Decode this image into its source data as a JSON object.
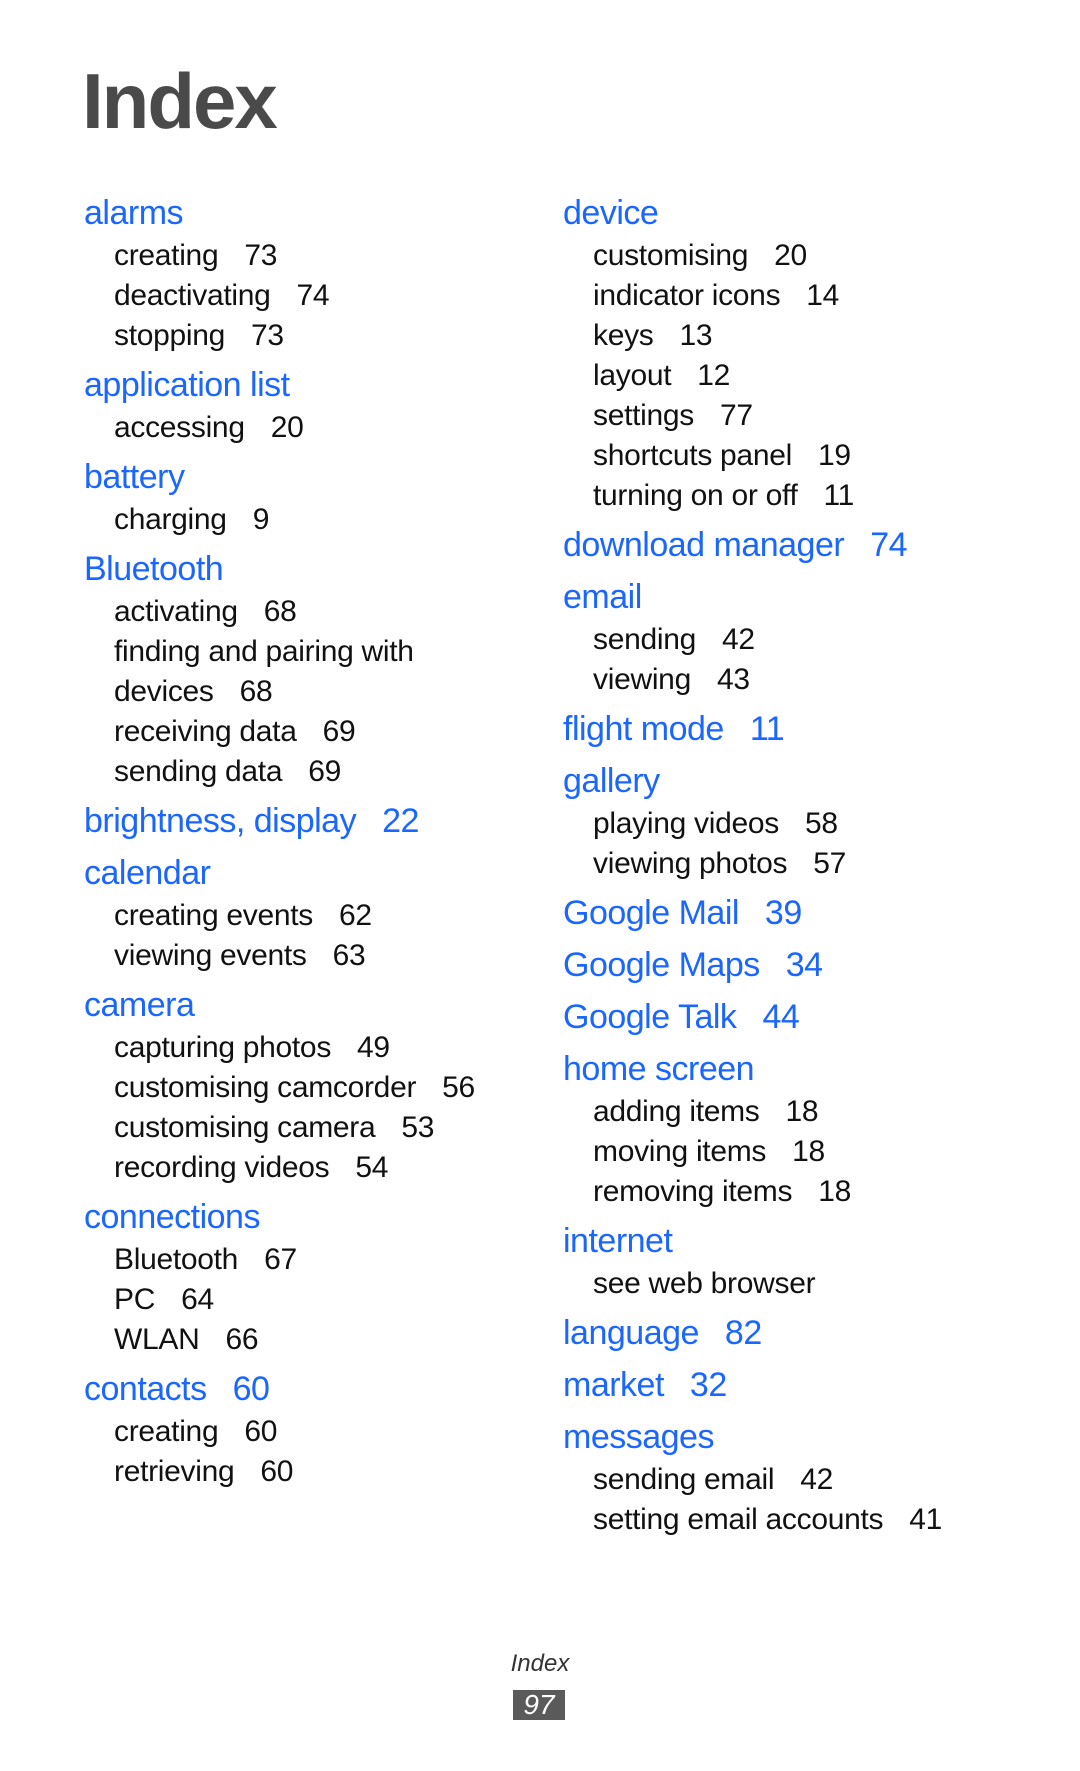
{
  "page": {
    "title": "Index",
    "footer_label": "Index",
    "page_number": "97",
    "accent_color": "#1a66ff"
  },
  "left": [
    {
      "term": "alarms",
      "page": "",
      "subs": [
        {
          "text": "creating",
          "page": "73"
        },
        {
          "text": "deactivating",
          "page": "74"
        },
        {
          "text": "stopping",
          "page": "73"
        }
      ]
    },
    {
      "term": "application list",
      "page": "",
      "subs": [
        {
          "text": "accessing",
          "page": "20"
        }
      ]
    },
    {
      "term": "battery",
      "page": "",
      "subs": [
        {
          "text": "charging",
          "page": "9"
        }
      ]
    },
    {
      "term": "Bluetooth",
      "page": "",
      "subs": [
        {
          "text": "activating",
          "page": "68"
        },
        {
          "text": "finding and pairing with",
          "page": ""
        },
        {
          "text": "devices",
          "page": "68"
        },
        {
          "text": "receiving data",
          "page": "69"
        },
        {
          "text": "sending data",
          "page": "69"
        }
      ]
    },
    {
      "term": "brightness, display",
      "page": "22",
      "subs": []
    },
    {
      "term": "calendar",
      "page": "",
      "subs": [
        {
          "text": "creating events",
          "page": "62"
        },
        {
          "text": "viewing events",
          "page": "63"
        }
      ]
    },
    {
      "term": "camera",
      "page": "",
      "subs": [
        {
          "text": "capturing photos",
          "page": "49"
        },
        {
          "text": "customising camcorder",
          "page": "56"
        },
        {
          "text": "customising camera",
          "page": "53"
        },
        {
          "text": "recording videos",
          "page": "54"
        }
      ]
    },
    {
      "term": "connections",
      "page": "",
      "subs": [
        {
          "text": "Bluetooth",
          "page": "67"
        },
        {
          "text": "PC",
          "page": "64"
        },
        {
          "text": "WLAN",
          "page": "66"
        }
      ]
    },
    {
      "term": "contacts",
      "page": "60",
      "subs": [
        {
          "text": "creating",
          "page": "60"
        },
        {
          "text": "retrieving",
          "page": "60"
        }
      ]
    }
  ],
  "right": [
    {
      "term": "device",
      "page": "",
      "subs": [
        {
          "text": "customising",
          "page": "20"
        },
        {
          "text": "indicator icons",
          "page": "14"
        },
        {
          "text": "keys",
          "page": "13"
        },
        {
          "text": "layout",
          "page": "12"
        },
        {
          "text": "settings",
          "page": "77"
        },
        {
          "text": "shortcuts panel",
          "page": "19"
        },
        {
          "text": "turning on or off",
          "page": "11"
        }
      ]
    },
    {
      "term": "download manager",
      "page": "74",
      "subs": []
    },
    {
      "term": "email",
      "page": "",
      "subs": [
        {
          "text": "sending",
          "page": "42"
        },
        {
          "text": "viewing",
          "page": "43"
        }
      ]
    },
    {
      "term": "flight mode",
      "page": "11",
      "subs": []
    },
    {
      "term": "gallery",
      "page": "",
      "subs": [
        {
          "text": "playing videos",
          "page": "58"
        },
        {
          "text": "viewing photos",
          "page": "57"
        }
      ]
    },
    {
      "term": "Google Mail",
      "page": "39",
      "subs": []
    },
    {
      "term": "Google Maps",
      "page": "34",
      "subs": []
    },
    {
      "term": "Google Talk",
      "page": "44",
      "subs": []
    },
    {
      "term": "home screen",
      "page": "",
      "subs": [
        {
          "text": "adding items",
          "page": "18"
        },
        {
          "text": "moving items",
          "page": "18"
        },
        {
          "text": "removing items",
          "page": "18"
        }
      ]
    },
    {
      "term": "internet",
      "page": "",
      "subs": [
        {
          "text": "see web browser",
          "page": ""
        }
      ]
    },
    {
      "term": "language",
      "page": "82",
      "subs": []
    },
    {
      "term": "market",
      "page": "32",
      "subs": []
    },
    {
      "term": "messages",
      "page": "",
      "subs": [
        {
          "text": "sending email",
          "page": "42"
        },
        {
          "text": "setting email accounts",
          "page": "41"
        }
      ]
    }
  ]
}
